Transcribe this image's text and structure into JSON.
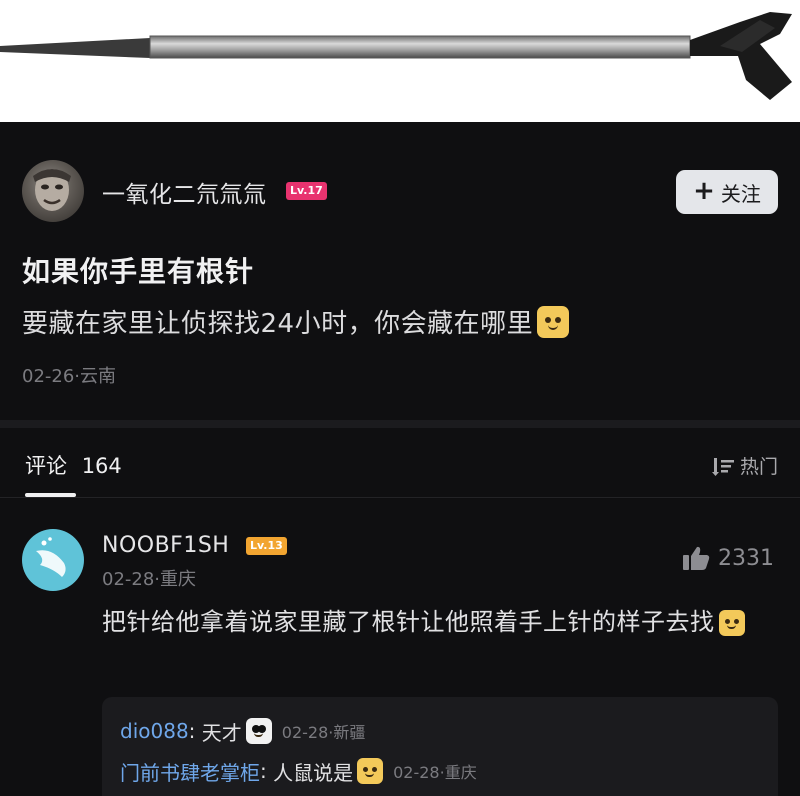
{
  "post": {
    "author": {
      "name": "一氧化二氘氚氚",
      "level": "Lv.17",
      "follow_label": "关注"
    },
    "title": "如果你手里有根针",
    "body": "要藏在家里让侦探找24小时，你会藏在哪里",
    "meta": "02-26·云南"
  },
  "comments_header": {
    "label": "评论",
    "count": "164",
    "sort_label": "热门"
  },
  "comment": {
    "user": "NOOBF1SH",
    "level": "Lv.13",
    "meta": "02-28·重庆",
    "likes": "2331",
    "text": "把针给他拿着说家里藏了根针让他照着手上针的样子去找",
    "replies": [
      {
        "user": "dio088",
        "text": "天才",
        "meta": "02-28·新疆"
      },
      {
        "user": "门前书肆老掌柜",
        "text": "人鼠说是",
        "meta": "02-28·重庆"
      }
    ]
  },
  "colors": {
    "background": "#0f0f11",
    "level_post": "#e8336f",
    "level_comment": "#f2a531",
    "reply_user": "#6fa7ea",
    "follow_bg": "#e4e6ea"
  },
  "icons": [
    "needle-image",
    "plus-icon",
    "sort-icon",
    "thumb-up-icon",
    "cat-emoji",
    "panda-emoji"
  ]
}
